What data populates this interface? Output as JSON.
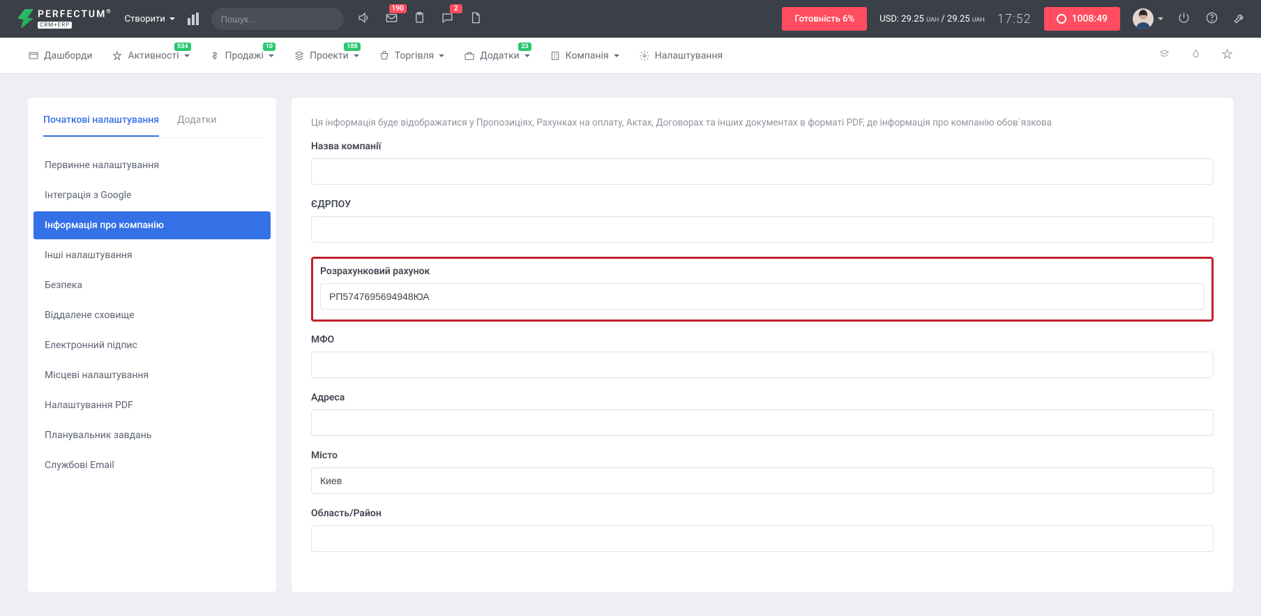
{
  "header": {
    "brand": "PERFECTUM",
    "brand_sub": "CRM+ERP",
    "create": "Створити",
    "search_placeholder": "Пошук...",
    "badge_mail": "190",
    "badge_chat": "2",
    "ready": "Готовність 6%",
    "usd": "USD: 29.25",
    "usd_cur": "UAH",
    "usd_sep": " / 29.25 ",
    "clock": "17:52",
    "timer": "1008:49"
  },
  "nav": {
    "items": [
      {
        "label": "Дашборди"
      },
      {
        "label": "Активності",
        "badge": "534"
      },
      {
        "label": "Продажі",
        "badge": "10"
      },
      {
        "label": "Проекти",
        "badge": "188"
      },
      {
        "label": "Торгівля"
      },
      {
        "label": "Додатки",
        "badge": "23"
      },
      {
        "label": "Компанія"
      },
      {
        "label": "Налаштування"
      }
    ]
  },
  "sidebar": {
    "tabs": {
      "a": "Початкові налаштування",
      "b": "Додатки"
    },
    "items": [
      "Первинне налаштування",
      "Інтеграція з Google",
      "Інформація про компанію",
      "Інші налаштування",
      "Безпека",
      "Віддалене сховище",
      "Електронний підпис",
      "Місцеві налаштування",
      "Налаштування PDF",
      "Планувальник завдань",
      "Службові Email"
    ]
  },
  "form": {
    "info": "Ця інформація буде відображатися у Пропозиціях, Рахунках на оплату, Актах, Договорах та інших документах в форматі PDF, де інформація про компанію обов´язкова",
    "company_name_lbl": "Назва компанії",
    "edrpou_lbl": "ЄДРПОУ",
    "account_lbl": "Розрахунковий рахунок",
    "account_val": "РП5747695694948ЮА",
    "mfo_lbl": "МФО",
    "address_lbl": "Адреса",
    "city_lbl": "Місто",
    "city_val": "Киев",
    "region_lbl": "Область/Район"
  }
}
